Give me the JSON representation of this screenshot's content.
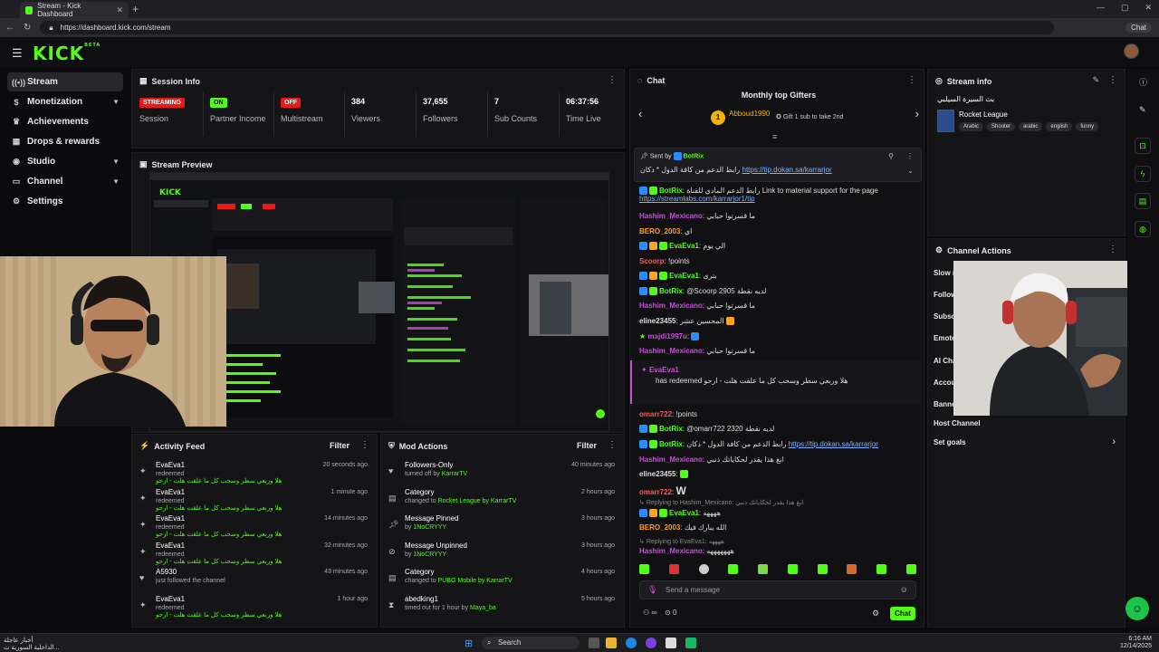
{
  "browser": {
    "tab_title": "Stream - Kick Dashboard",
    "url": "https://dashboard.kick.com/stream",
    "chat_button": "Chat"
  },
  "header": {
    "logo": "KICK",
    "logo_sup": "BETA"
  },
  "sidebar": {
    "items": [
      {
        "label": "Stream",
        "icon": "broadcast-icon"
      },
      {
        "label": "Monetization",
        "icon": "dollar-icon"
      },
      {
        "label": "Achievements",
        "icon": "trophy-icon"
      },
      {
        "label": "Drops & rewards",
        "icon": "gift-icon"
      },
      {
        "label": "Studio",
        "icon": "camera-icon"
      },
      {
        "label": "Channel",
        "icon": "channel-icon"
      },
      {
        "label": "Settings",
        "icon": "gear-icon"
      }
    ]
  },
  "session": {
    "title": "Session Info",
    "stats": [
      {
        "value": "STREAMING",
        "label": "Session"
      },
      {
        "value": "ON",
        "label": "Partner Income"
      },
      {
        "value": "OFF",
        "label": "Multistream"
      },
      {
        "value": "384",
        "label": "Viewers"
      },
      {
        "value": "37,655",
        "label": "Followers"
      },
      {
        "value": "7",
        "label": "Sub Counts"
      },
      {
        "value": "06:37:56",
        "label": "Time Live"
      }
    ]
  },
  "preview": {
    "title": "Stream Preview"
  },
  "activity": {
    "title": "Activity Feed",
    "filter": "Filter",
    "rows": [
      {
        "name": "EvaEva1",
        "action": "redeemed",
        "detail": "هلا وربعي سطر وسحب كل ما علقت هلت - ارحو",
        "time": "20 seconds ago"
      },
      {
        "name": "EvaEva1",
        "action": "redeemed",
        "detail": "هلا وربعي سطر وسحب كل ما علقت هلت - ارحو",
        "time": "1 minute ago"
      },
      {
        "name": "EvaEva1",
        "action": "redeemed",
        "detail": "هلا وربعي سطر وسحب كل ما علقت هلت - ارحو",
        "time": "14 minutes ago"
      },
      {
        "name": "EvaEva1",
        "action": "redeemed",
        "detail": "هلا وربعي سطر وسحب كل ما علقت هلت - ارحو",
        "time": "32 minutes ago"
      },
      {
        "name": "A5930",
        "action": "just followed the channel",
        "detail": "",
        "time": "43 minutes ago"
      },
      {
        "name": "EvaEva1",
        "action": "redeemed",
        "detail": "هلا وربعي سطر وسحب كل ما علقت هلت - ارحو",
        "time": "1 hour ago"
      }
    ]
  },
  "mod": {
    "title": "Mod Actions",
    "filter": "Filter",
    "rows": [
      {
        "name": "Followers-Only",
        "action": "turned off by",
        "target": "KarrarTV",
        "time": "40 minutes ago"
      },
      {
        "name": "Category",
        "action": "changed to",
        "target": "Rocket League by KarrarTV",
        "time": "2 hours ago"
      },
      {
        "name": "Message Pinned",
        "action": "by",
        "target": "1NoCRYYY",
        "time": "3 hours ago"
      },
      {
        "name": "Message Unpinned",
        "action": "by",
        "target": "1NoCRYYY",
        "time": "3 hours ago"
      },
      {
        "name": "Category",
        "action": "changed to",
        "target": "PUBG Mobile by KarrarTV",
        "time": "4 hours ago"
      },
      {
        "name": "abedking1",
        "action": "timed out for 1 hour by",
        "target": "Maya_ba",
        "time": "5 hours ago"
      }
    ]
  },
  "chat": {
    "title": "Chat",
    "gifters_title": "Monthly top Gifters",
    "gifter_name": "Abboud1990",
    "gifter_count": "1",
    "gift_cta": "Gift 1 sub to take 2nd",
    "pinned_by": "Sent by",
    "pinned_user": "BotRix",
    "pinned_text": "رابط الدعم من كافة الدول * دكان",
    "pinned_link": "https://tip.dokan.sa/karrarjor",
    "input_placeholder": "Send a message",
    "send_label": "Chat",
    "count": "0",
    "messages": [
      {
        "user": "BotRix",
        "text": "رابط الدعم المادي للقناة Link to material support for the page",
        "link": "https://streamlabs.com/karrarjor1/tip"
      },
      {
        "user": "Hashim_Mexicano",
        "text": "ما قسرتوا حبابي"
      },
      {
        "user": "BERO_2003",
        "text": "اي"
      },
      {
        "user": "EvaEva1",
        "text": "الي يوم"
      },
      {
        "user": "Scoorp",
        "text": "!points"
      },
      {
        "user": "EvaEva1",
        "text": "بترى"
      },
      {
        "user": "BotRix",
        "text": "@Scoorp 2905 لديه نقطة"
      },
      {
        "user": "Hashim_Mexicano",
        "text": "ما قسرتوا حبابي"
      },
      {
        "user": "eline23455",
        "text": "المحسين عشر"
      },
      {
        "user": "majdi1997u",
        "text": ""
      },
      {
        "user": "Hashim_Mexicano",
        "text": "ما قسرتوا حبابي"
      },
      {
        "user": "EvaEva1",
        "text": "has redeemed",
        "detail": "هلا وربعي سطر وسحب كل ما علقت هلت - ارحو"
      },
      {
        "user": "omarr722",
        "text": "!points"
      },
      {
        "user": "BotRix",
        "text": "@omarr722 2320 لديه نقطة"
      },
      {
        "user": "BotRix",
        "text": "رابط الدعم من كافة الدول * دكان",
        "link": "https://tip.dokan.sa/karrarjor"
      },
      {
        "user": "Hashim_Mexicano",
        "text": "ابغ هذا يقدر لحكاياتك ذنبي"
      },
      {
        "user": "eline23455",
        "text": ""
      },
      {
        "user": "omarr722",
        "text": "W"
      },
      {
        "user": "Replying to Hashim_Mexicano",
        "text": "ابغ هذا يقدر لحكاياتك ذنبي"
      },
      {
        "user": "EvaEva1",
        "text": "ههههه"
      },
      {
        "user": "BERO_2003",
        "text": "الله يبارك فيك"
      },
      {
        "user": "Replying to EvaEva1",
        "text": "ههههه"
      },
      {
        "user": "Hashim_Mexicano",
        "text": "هههههههه"
      }
    ]
  },
  "streaminfo": {
    "title": "Stream info",
    "stream_title": "بث السيرة السيلبي",
    "category": "Rocket League",
    "tags": [
      "Arabic",
      "Shooter",
      "arabic",
      "english",
      "funny"
    ]
  },
  "channel_actions": {
    "title": "Channel Actions",
    "items": [
      "Slow m",
      "Follow",
      "Subsc",
      "Emote",
      "AI Cha",
      "Accou",
      "Banne",
      "Host Channel",
      "Set goals"
    ]
  },
  "taskbar": {
    "weather": "أخبار عاجلة",
    "weather_sub": "الداخلية السورية ت...",
    "search": "Search",
    "time": "6:16 AM",
    "date": "12/14/2025"
  }
}
